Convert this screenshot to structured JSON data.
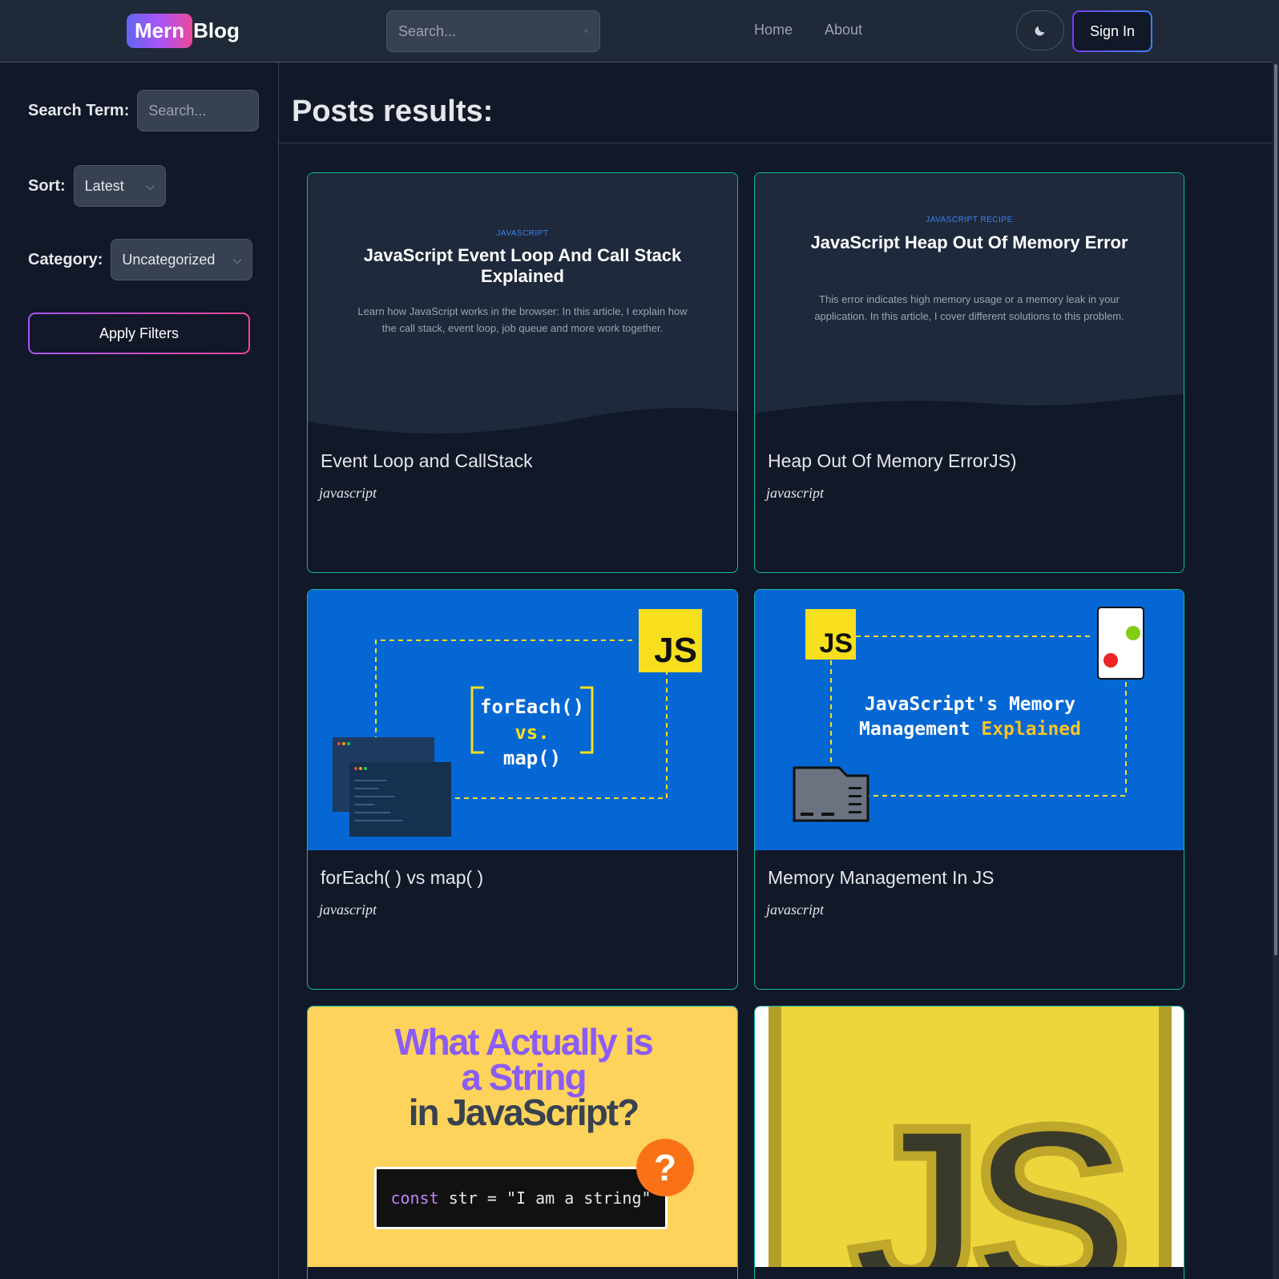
{
  "header": {
    "logo_badge": "Mern",
    "logo_text": "Blog",
    "search_placeholder": "Search...",
    "nav": [
      "Home",
      "About"
    ],
    "signin_label": "Sign In"
  },
  "sidebar": {
    "search_label": "Search Term:",
    "search_placeholder": "Search...",
    "sort_label": "Sort:",
    "sort_value": "Latest",
    "category_label": "Category:",
    "category_value": "Uncategorized",
    "apply_label": "Apply Filters"
  },
  "main": {
    "title": "Posts results:",
    "posts": [
      {
        "title": "Event Loop and CallStack",
        "category": "javascript",
        "thumb": {
          "kicker": "JAVASCRIPT",
          "heading": "JavaScript Event Loop And Call Stack Explained",
          "desc": "Learn how JavaScript works in the browser: In this article, I explain how the call stack, event loop, job queue and more work together."
        }
      },
      {
        "title": "Heap Out Of Memory ErrorJS)",
        "category": "javascript",
        "thumb": {
          "kicker": "JAVASCRIPT  RECIPE",
          "heading": "JavaScript Heap Out Of Memory Error",
          "desc": "This error indicates high memory usage or a memory leak in your application. In this article, I cover different solutions to this problem."
        }
      },
      {
        "title": "forEach( ) vs map( )",
        "category": "javascript",
        "thumb": {
          "badge": "JS",
          "line1": "forEach()",
          "line2_a": "vs.",
          "line2_b": "map()"
        }
      },
      {
        "title": "Memory Management In JS",
        "category": "javascript",
        "thumb": {
          "badge": "JS",
          "line1": "JavaScript's Memory",
          "line2_a": "Management",
          "line2_b": "Explained"
        }
      },
      {
        "thumb": {
          "line1": "What Actually is",
          "line2": "a String",
          "line3": "in JavaScript?",
          "code_kw": "const",
          "code_rest": " str = \"I am a string\"",
          "q": "?"
        }
      },
      {
        "thumb": {
          "logo": "JS"
        }
      }
    ]
  },
  "colors": {
    "accent_teal": "#14b8a6",
    "brand_gradient": [
      "#6366f1",
      "#a855f7",
      "#ec4899"
    ],
    "js_yellow": "#f7df1e"
  }
}
